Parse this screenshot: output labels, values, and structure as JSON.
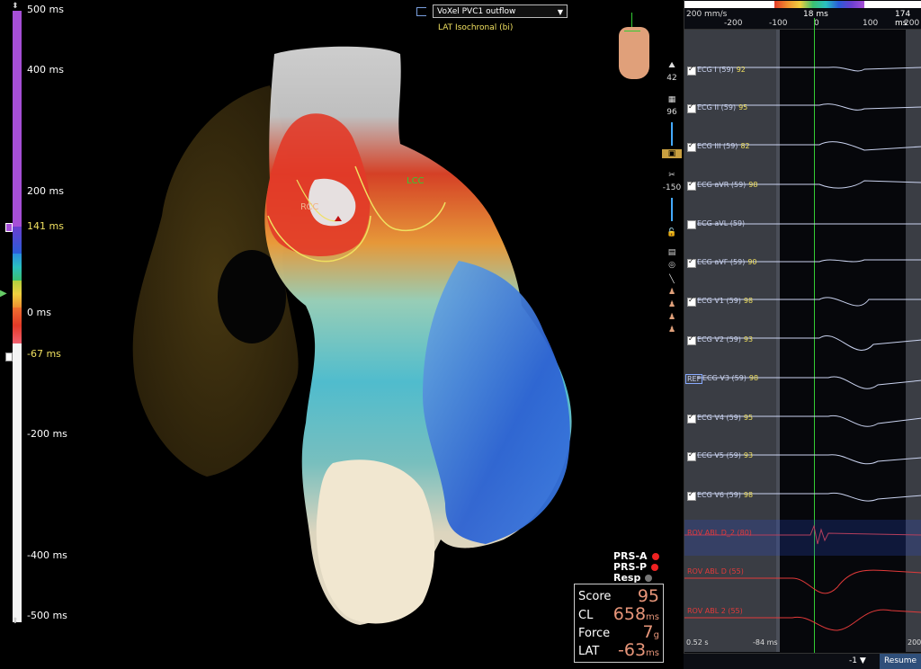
{
  "colors": {
    "accent": "#a64fd6",
    "lat_early": "#e23a3a",
    "lat_late": "#2a5cd8",
    "highlight": "#f0e060"
  },
  "scale": {
    "ticks": [
      {
        "label": "500 ms",
        "highlight": false
      },
      {
        "label": "400 ms",
        "highlight": false
      },
      {
        "label": "200 ms",
        "highlight": false
      },
      {
        "label": "141 ms",
        "highlight": true
      },
      {
        "label": "0 ms",
        "highlight": false
      },
      {
        "label": "-67 ms",
        "highlight": true
      },
      {
        "label": "-200 ms",
        "highlight": false
      },
      {
        "label": "-400 ms",
        "highlight": false
      },
      {
        "label": "-500 ms",
        "highlight": false
      }
    ]
  },
  "map": {
    "dropdown_value": "VoXel PVC1 outflow",
    "subtitle": "LAT Isochronal (bi)",
    "labels": {
      "rcc": "RCC",
      "lcc": "LCC"
    }
  },
  "legend": {
    "prs_a": "PRS-A",
    "prs_p": "PRS-P",
    "resp": "Resp"
  },
  "stats": {
    "score_label": "Score",
    "score_value": "95",
    "cl_label": "CL",
    "cl_value": "658",
    "cl_unit": "ms",
    "force_label": "Force",
    "force_value": "7",
    "force_unit": "g",
    "lat_label": "LAT",
    "lat_value": "-63",
    "lat_unit": "ms"
  },
  "tools": {
    "opacity_value": "42",
    "value_96": "96",
    "value_neg150": "-150"
  },
  "egm": {
    "sweep": "200 mm/s",
    "ruler_ticks": [
      "-200",
      "-100",
      "0",
      "100",
      "200"
    ],
    "marker_left": "18 ms",
    "marker_right": "174 ms",
    "ref_label": "REF",
    "channels": [
      {
        "name": "ECG I (59)",
        "score": "92",
        "checked": true
      },
      {
        "name": "ECG II (59)",
        "score": "95",
        "checked": true
      },
      {
        "name": "ECG III (59)",
        "score": "82",
        "checked": true
      },
      {
        "name": "ECG aVR (59)",
        "score": "98",
        "checked": true
      },
      {
        "name": "ECG aVL (59)",
        "score": "",
        "checked": false
      },
      {
        "name": "ECG aVF (59)",
        "score": "90",
        "checked": true
      },
      {
        "name": "ECG V1 (59)",
        "score": "98",
        "checked": true
      },
      {
        "name": "ECG V2 (59)",
        "score": "93",
        "checked": true
      },
      {
        "name": "ECG V3 (59)",
        "score": "98",
        "checked": false,
        "ref": true
      },
      {
        "name": "ECG V4 (59)",
        "score": "95",
        "checked": true
      },
      {
        "name": "ECG V5 (59)",
        "score": "93",
        "checked": true
      },
      {
        "name": "ECG V6 (59)",
        "score": "98",
        "checked": true
      }
    ],
    "abl_channels": [
      {
        "name": "ROV ABL D_2 (80)"
      },
      {
        "name": "ROV ABL D (55)"
      },
      {
        "name": "ROV ABL 2 (55)"
      }
    ],
    "bottom_left": "0.52 s",
    "bottom_mid": "-84 ms",
    "bottom_right": "200"
  },
  "footer": {
    "counter": "-1 ▼",
    "resume": "Resume"
  }
}
